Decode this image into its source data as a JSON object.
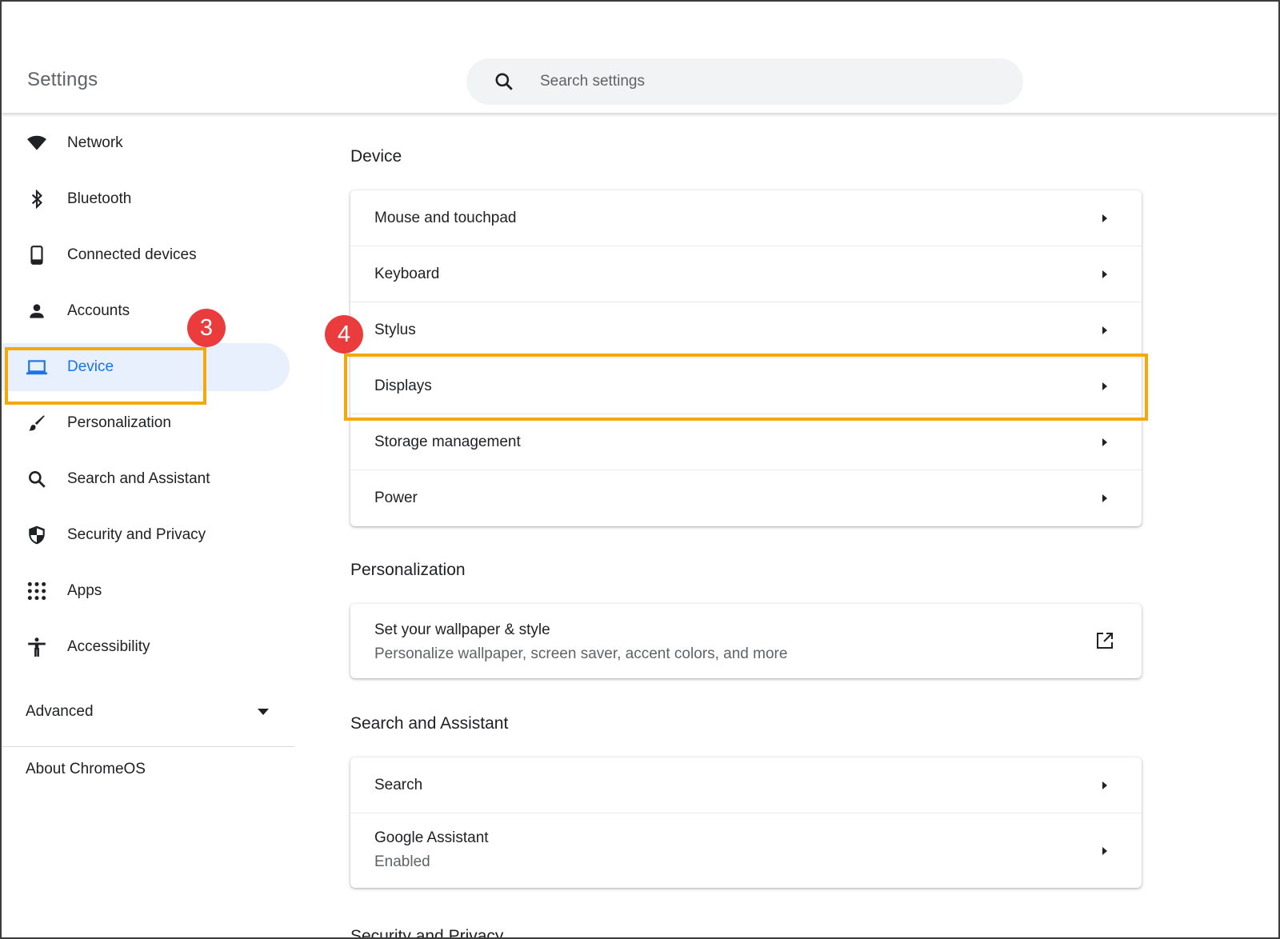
{
  "window": {
    "title": "Settings"
  },
  "search": {
    "placeholder": "Search settings"
  },
  "sidebar": {
    "items": [
      {
        "label": "Network",
        "icon": "wifi-icon"
      },
      {
        "label": "Bluetooth",
        "icon": "bluetooth-icon"
      },
      {
        "label": "Connected devices",
        "icon": "phone-icon"
      },
      {
        "label": "Accounts",
        "icon": "person-icon"
      },
      {
        "label": "Device",
        "icon": "laptop-icon",
        "active": true
      },
      {
        "label": "Personalization",
        "icon": "brush-icon"
      },
      {
        "label": "Search and Assistant",
        "icon": "search-icon"
      },
      {
        "label": "Security and Privacy",
        "icon": "shield-icon"
      },
      {
        "label": "Apps",
        "icon": "apps-grid-icon"
      },
      {
        "label": "Accessibility",
        "icon": "accessibility-icon"
      }
    ],
    "advanced_label": "Advanced",
    "about_label": "About ChromeOS"
  },
  "sections": {
    "device": {
      "title": "Device",
      "rows": [
        "Mouse and touchpad",
        "Keyboard",
        "Stylus",
        "Displays",
        "Storage management",
        "Power"
      ]
    },
    "personalization": {
      "title": "Personalization",
      "row_label": "Set your wallpaper & style",
      "row_sub": "Personalize wallpaper, screen saver, accent colors, and more"
    },
    "search_assistant": {
      "title": "Search and Assistant",
      "search_label": "Search",
      "assistant_label": "Google Assistant",
      "assistant_sub": "Enabled"
    },
    "security": {
      "title": "Security and Privacy"
    }
  },
  "annotations": {
    "step3": "3",
    "step4": "4"
  },
  "colors": {
    "accent": "#1a73e8",
    "active_bg": "#e8f0fe",
    "highlight": "#f4a809",
    "badge": "#ea3c3c"
  }
}
